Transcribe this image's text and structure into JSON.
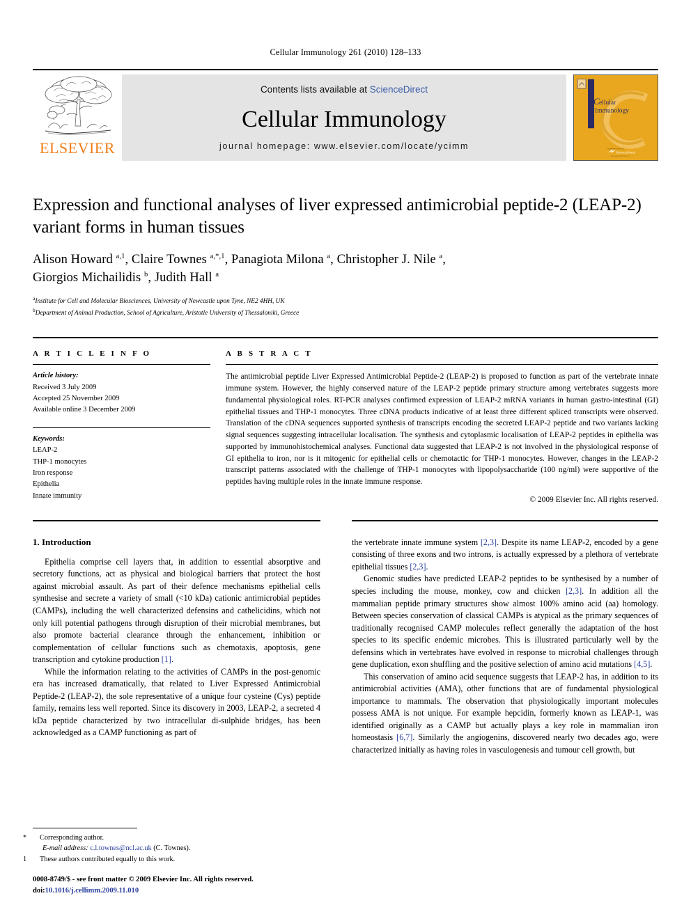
{
  "running_head": "Cellular Immunology 261 (2010) 128–133",
  "masthead": {
    "publisher_name": "ELSEVIER",
    "contents_prefix": "Contents lists available at ",
    "contents_link": "ScienceDirect",
    "journal_title": "Cellular Immunology",
    "homepage": "journal homepage: www.elsevier.com/locate/ycimm",
    "cover_title_line1": "ellular",
    "cover_title_line2": "Immunology",
    "cover_badge": "ScienceDirect",
    "colors": {
      "elsevier_orange": "#f07c16",
      "sciencedirect_blue": "#3b5ca8",
      "band_gray": "#e4e4e4",
      "cover_amber": "#e8a71f",
      "cover_navy": "#2c2a63",
      "link_blue": "#2a3f9d"
    }
  },
  "article": {
    "title": "Expression and functional analyses of liver expressed antimicrobial peptide-2 (LEAP-2) variant forms in human tissues",
    "authors_line1_html": "Alison Howard <sup>a,1</sup>, Claire Townes <sup>a,*,1</sup>, Panagiota Milona <sup>a</sup>, Christopher J. Nile <sup>a</sup>,",
    "authors_line2_html": "Giorgios Michailidis <sup>b</sup>, Judith Hall <sup>a</sup>",
    "affiliation_a": "Institute for Cell and Molecular Biosciences, University of Newcastle upon Tyne, NE2 4HH, UK",
    "affiliation_b": "Department of Animal Production, School of Agriculture, Aristotle University of Thessaloniki, Greece"
  },
  "article_info": {
    "heading": "A R T I C L E   I N F O",
    "history_label": "Article history:",
    "received": "Received 3 July 2009",
    "accepted": "Accepted 25 November 2009",
    "available_online": "Available online 3 December 2009",
    "keywords_label": "Keywords:",
    "keywords": [
      "LEAP-2",
      "THP-1 monocytes",
      "Iron response",
      "Epithelia",
      "Innate immunity"
    ]
  },
  "abstract": {
    "heading": "A B S T R A C T",
    "text": "The antimicrobial peptide Liver Expressed Antimicrobial Peptide-2 (LEAP-2) is proposed to function as part of the vertebrate innate immune system. However, the highly conserved nature of the LEAP-2 peptide primary structure among vertebrates suggests more fundamental physiological roles. RT-PCR analyses confirmed expression of LEAP-2 mRNA variants in human gastro-intestinal (GI) epithelial tissues and THP-1 monocytes. Three cDNA products indicative of at least three different spliced transcripts were observed. Translation of the cDNA sequences supported synthesis of transcripts encoding the secreted LEAP-2 peptide and two variants lacking signal sequences suggesting intracellular localisation. The synthesis and cytoplasmic localisation of LEAP-2 peptides in epithelia was supported by immunohistochemical analyses. Functional data suggested that LEAP-2 is not involved in the physiological response of GI epithelia to iron, nor is it mitogenic for epithelial cells or chemotactic for THP-1 monocytes. However, changes in the LEAP-2 transcript patterns associated with the challenge of THP-1 monocytes with lipopolysaccharide (100 ng/ml) were supportive of the peptides having multiple roles in the innate immune response.",
    "copyright": "© 2009 Elsevier Inc. All rights reserved."
  },
  "body": {
    "section_title": "1. Introduction",
    "left_paragraphs": [
      "Epithelia comprise cell layers that, in addition to essential absorptive and secretory functions, act as physical and biological barriers that protect the host against microbial assault. As part of their defence mechanisms epithelial cells synthesise and secrete a variety of small (<10 kDa) cationic antimicrobial peptides (CAMPs), including the well characterized defensins and cathelicidins, which not only kill potential pathogens through disruption of their microbial membranes, but also promote bacterial clearance through the enhancement, inhibition or complementation of cellular functions such as chemotaxis, apoptosis, gene transcription and cytokine production [1].",
      "While the information relating to the activities of CAMPs in the post-genomic era has increased dramatically, that related to Liver Expressed Antimicrobial Peptide-2 (LEAP-2), the sole representative of a unique four cysteine (Cys) peptide family, remains less well reported. Since its discovery in 2003, LEAP-2, a secreted 4 kDa peptide characterized by two intracellular di-sulphide bridges, has been acknowledged as a CAMP functioning as part of"
    ],
    "right_paragraphs": [
      "the vertebrate innate immune system [2,3]. Despite its name LEAP-2, encoded by a gene consisting of three exons and two introns, is actually expressed by a plethora of vertebrate epithelial tissues [2,3].",
      "Genomic studies have predicted LEAP-2 peptides to be synthesised by a number of species including the mouse, monkey, cow and chicken [2,3]. In addition all the mammalian peptide primary structures show almost 100% amino acid (aa) homology. Between species conservation of classical CAMPs is atypical as the primary sequences of traditionally recognised CAMP molecules reflect generally the adaptation of the host species to its specific endemic microbes. This is illustrated particularly well by the defensins which in vertebrates have evolved in response to microbial challenges through gene duplication, exon shuffling and the positive selection of amino acid mutations [4,5].",
      "This conservation of amino acid sequence suggests that LEAP-2 has, in addition to its antimicrobial activities (AMA), other functions that are of fundamental physiological importance to mammals. The observation that physiologically important molecules possess AMA is not unique. For example hepcidin, formerly known as LEAP-1, was identified originally as a CAMP but actually plays a key role in mammalian iron homeostasis [6,7]. Similarly the angiogenins, discovered nearly two decades ago, were characterized initially as having roles in vasculogenesis and tumour cell growth, but"
    ]
  },
  "footnotes": {
    "corresponding_mark": "*",
    "corresponding_text": "Corresponding author.",
    "email_label": "E-mail address:",
    "email": "c.l.townes@ncl.ac.uk",
    "email_suffix": "(C. Townes).",
    "equal_mark": "1",
    "equal_text": "These authors contributed equally to this work.",
    "issn_line": "0008-8749/$ - see front matter © 2009 Elsevier Inc. All rights reserved.",
    "doi_label": "doi:",
    "doi_value": "10.1016/j.cellimm.2009.11.010"
  }
}
